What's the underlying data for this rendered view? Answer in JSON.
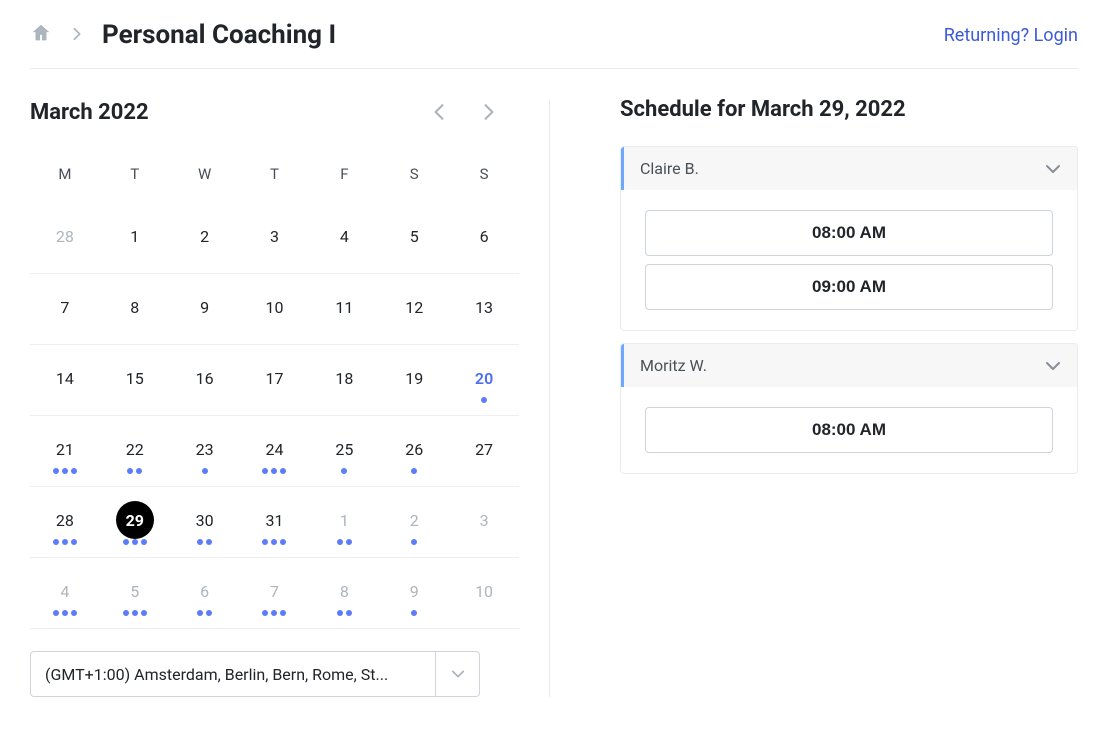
{
  "header": {
    "title": "Personal Coaching I",
    "login_label": "Returning? Login"
  },
  "calendar": {
    "month_label": "March 2022",
    "day_headers": [
      "M",
      "T",
      "W",
      "T",
      "F",
      "S",
      "S"
    ],
    "weeks": [
      [
        {
          "n": "28",
          "muted": true,
          "dots": 0
        },
        {
          "n": "1",
          "dots": 0
        },
        {
          "n": "2",
          "dots": 0
        },
        {
          "n": "3",
          "dots": 0
        },
        {
          "n": "4",
          "dots": 0
        },
        {
          "n": "5",
          "dots": 0
        },
        {
          "n": "6",
          "dots": 0
        }
      ],
      [
        {
          "n": "7",
          "dots": 0
        },
        {
          "n": "8",
          "dots": 0
        },
        {
          "n": "9",
          "dots": 0
        },
        {
          "n": "10",
          "dots": 0
        },
        {
          "n": "11",
          "dots": 0
        },
        {
          "n": "12",
          "dots": 0
        },
        {
          "n": "13",
          "dots": 0
        }
      ],
      [
        {
          "n": "14",
          "dots": 0
        },
        {
          "n": "15",
          "dots": 0
        },
        {
          "n": "16",
          "dots": 0
        },
        {
          "n": "17",
          "dots": 0
        },
        {
          "n": "18",
          "dots": 0
        },
        {
          "n": "19",
          "dots": 0
        },
        {
          "n": "20",
          "dots": 1,
          "accent": true
        }
      ],
      [
        {
          "n": "21",
          "dots": 3
        },
        {
          "n": "22",
          "dots": 2
        },
        {
          "n": "23",
          "dots": 1
        },
        {
          "n": "24",
          "dots": 3
        },
        {
          "n": "25",
          "dots": 1
        },
        {
          "n": "26",
          "dots": 1
        },
        {
          "n": "27",
          "dots": 0
        }
      ],
      [
        {
          "n": "28",
          "dots": 3
        },
        {
          "n": "29",
          "dots": 3,
          "selected": true
        },
        {
          "n": "30",
          "dots": 2
        },
        {
          "n": "31",
          "dots": 3
        },
        {
          "n": "1",
          "muted": true,
          "dots": 2
        },
        {
          "n": "2",
          "muted": true,
          "dots": 1
        },
        {
          "n": "3",
          "muted": true,
          "dots": 0
        }
      ],
      [
        {
          "n": "4",
          "muted": true,
          "dots": 3
        },
        {
          "n": "5",
          "muted": true,
          "dots": 3
        },
        {
          "n": "6",
          "muted": true,
          "dots": 2
        },
        {
          "n": "7",
          "muted": true,
          "dots": 3
        },
        {
          "n": "8",
          "muted": true,
          "dots": 2
        },
        {
          "n": "9",
          "muted": true,
          "dots": 1
        },
        {
          "n": "10",
          "muted": true,
          "dots": 0
        }
      ]
    ]
  },
  "timezone": {
    "selected": "(GMT+1:00) Amsterdam, Berlin, Bern, Rome, St..."
  },
  "schedule": {
    "title": "Schedule for March 29, 2022",
    "coaches": [
      {
        "name": "Claire B.",
        "slots": [
          "08:00 AM",
          "09:00 AM"
        ]
      },
      {
        "name": "Moritz W.",
        "slots": [
          "08:00 AM"
        ]
      }
    ]
  }
}
